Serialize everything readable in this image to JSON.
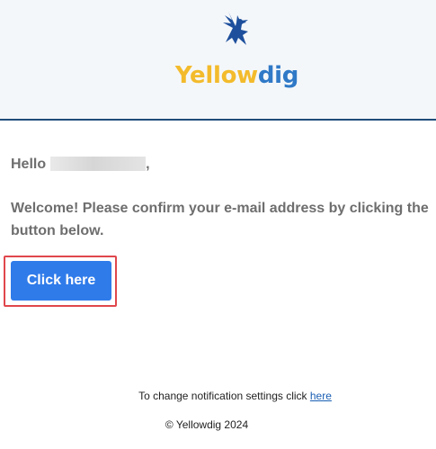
{
  "header": {
    "logo_icon": "eagle-icon",
    "wordmark_part1": "Yellow",
    "wordmark_part2": "dig"
  },
  "body": {
    "greeting_prefix": "Hello",
    "greeting_suffix": ",",
    "message": "Welcome! Please confirm your e-mail address by clicking the button below.",
    "cta_label": "Click here"
  },
  "footer": {
    "notification_text": "To change notification settings click",
    "notification_link": "here",
    "copyright": "© Yellowdig 2024"
  },
  "colors": {
    "brand_yellow": "#f3bb2c",
    "brand_blue": "#2f79c7",
    "button_blue": "#2f7bea",
    "highlight_red": "#e0474c"
  }
}
